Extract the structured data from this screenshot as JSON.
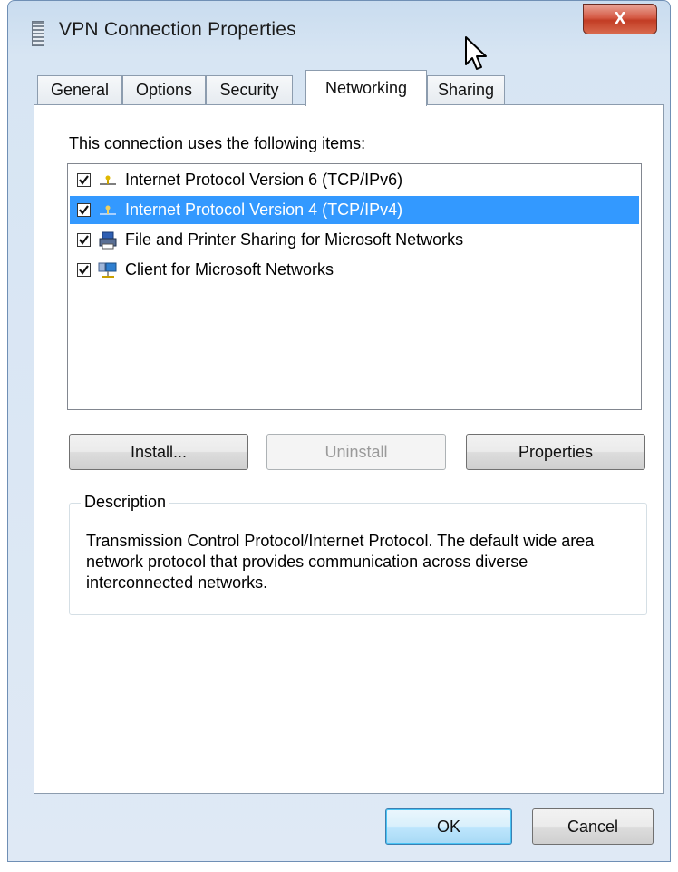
{
  "window": {
    "title": "VPN Connection Properties",
    "close_label": "X"
  },
  "tabs": [
    {
      "label": "General"
    },
    {
      "label": "Options"
    },
    {
      "label": "Security"
    },
    {
      "label": "Networking",
      "active": true
    },
    {
      "label": "Sharing"
    }
  ],
  "networking": {
    "items_label": "This connection uses the following items:",
    "items": [
      {
        "label": "Internet Protocol Version 6 (TCP/IPv6)",
        "checked": true,
        "icon": "network-protocol-icon"
      },
      {
        "label": "Internet Protocol Version 4 (TCP/IPv4)",
        "checked": true,
        "icon": "network-protocol-icon",
        "selected": true
      },
      {
        "label": "File and Printer Sharing for Microsoft Networks",
        "checked": true,
        "icon": "printer-sharing-icon"
      },
      {
        "label": "Client for Microsoft Networks",
        "checked": true,
        "icon": "network-client-icon"
      }
    ],
    "buttons": {
      "install": "Install...",
      "uninstall": "Uninstall",
      "properties": "Properties"
    },
    "description": {
      "legend": "Description",
      "text": "Transmission Control Protocol/Internet Protocol. The default wide area network protocol that provides communication across diverse interconnected networks."
    }
  },
  "footer": {
    "ok": "OK",
    "cancel": "Cancel"
  },
  "colors": {
    "selection": "#3399ff",
    "close_button": "#c23c24",
    "title_bar": "#c9dcef"
  }
}
